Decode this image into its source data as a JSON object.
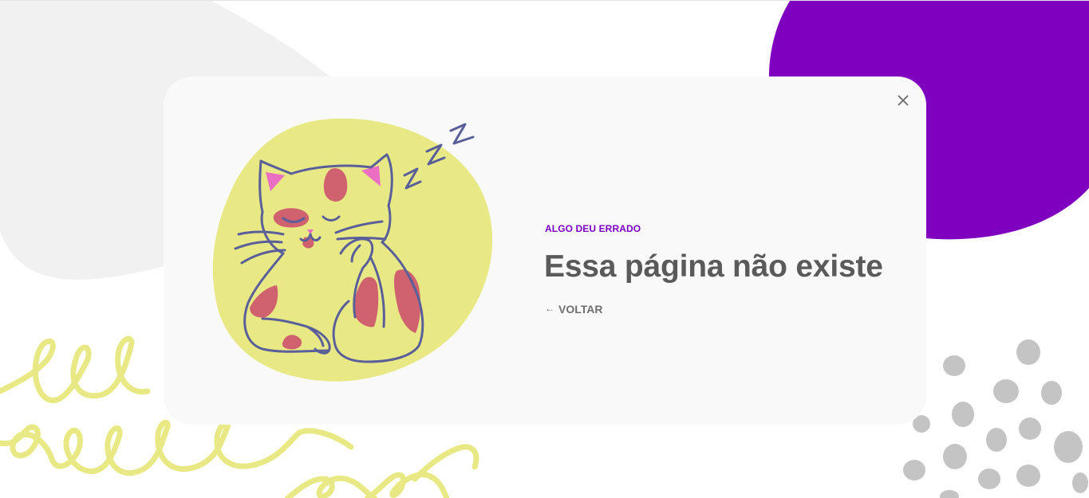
{
  "error_card": {
    "eyebrow": "ALGO DEU ERRADO",
    "title": "Essa página não existe",
    "back_label": "VOLTAR",
    "back_icon": "arrow-left-icon",
    "close_icon": "close-icon",
    "illustration": "sleeping-cat"
  },
  "colors": {
    "accent_purple": "#7a00c2",
    "purple_blob": "#8000c0",
    "yellow": "#e8e985",
    "cat_outline": "#5a5f9a",
    "cat_spots": "#cf626e",
    "cat_ears": "#ea6fc2",
    "dots_gray": "#c4c4c4",
    "title_text": "#5a5a5a"
  }
}
